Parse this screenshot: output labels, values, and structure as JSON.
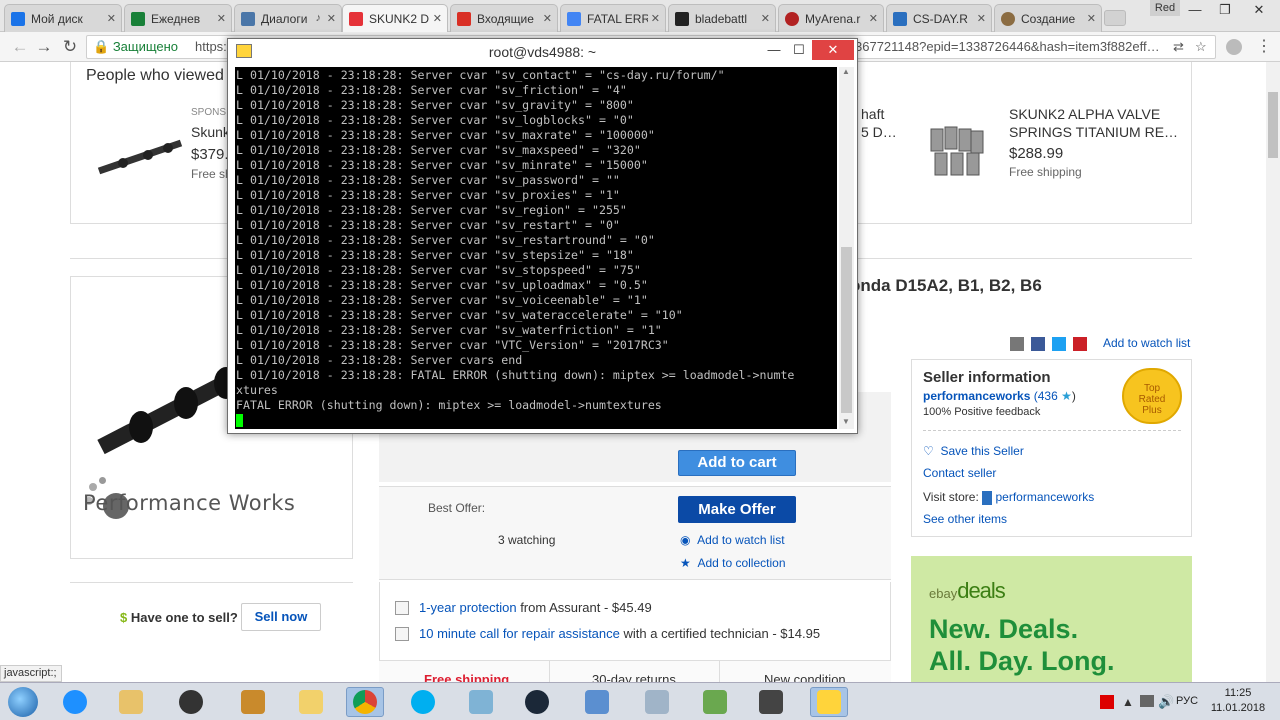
{
  "browser": {
    "tabs": [
      {
        "label": "Мой диск",
        "color": "#1a73e8"
      },
      {
        "label": "Ежеднев",
        "color": "#188038"
      },
      {
        "label": "Диалоги",
        "color": "#4a76a8"
      },
      {
        "label": "SKUNK2 D",
        "color": "#e53238"
      },
      {
        "label": "Входящие",
        "color": "#d93025"
      },
      {
        "label": "FATAL ERR",
        "color": "#4285f4"
      },
      {
        "label": "bladebattl",
        "color": "#222222"
      },
      {
        "label": "MyArena.r",
        "color": "#b22222"
      },
      {
        "label": "CS-DAY.R",
        "color": "#2a6fbf"
      },
      {
        "label": "Создание",
        "color": "#8b6c42"
      }
    ],
    "profile_label": "Red",
    "secure_label": "Защищено",
    "url_start": "https:",
    "url_tail": "367721148?epid=1338726446&hash=item3f882eff…",
    "status_text": "javascript:;"
  },
  "page": {
    "people_viewed": "People who viewed",
    "sponsored": "SPONS",
    "item1": {
      "title": "Skunk",
      "price": "$379.",
      "shipping": "Free sh"
    },
    "item2": {
      "title_l1": "haft",
      "title_l2": "5 D…"
    },
    "item3": {
      "title_l1": "SKUNK2 ALPHA VALVE",
      "title_l2": "SPRINGS TITANIUM RE…",
      "price": "$288.99",
      "shipping": "Free shipping"
    },
    "main_title": "onda D15A2, B1, B2, B6",
    "add_to_watch_top": "Add to watch list",
    "seller": {
      "heading": "Seller information",
      "name": "performanceworks",
      "score": "(436",
      "score_close": ")",
      "feedback": "100% Positive feedback",
      "badge_l1": "Top",
      "badge_l2": "Rated",
      "badge_l3": "Plus",
      "save": "Save this Seller",
      "contact": "Contact seller",
      "visit_label": "Visit store:",
      "store": "performanceworks",
      "other": "See other items"
    },
    "logo_text": "Performance Works",
    "add_to_cart": "Add to cart",
    "best_offer": "Best Offer:",
    "make_offer": "Make Offer",
    "watching": "3 watching",
    "add_watch": "Add to watch list",
    "add_collection": "Add to collection",
    "protection": {
      "link": "1-year protection",
      "rest": "from Assurant - $45.49"
    },
    "repair": {
      "link": "10 minute call for repair assistance",
      "rest": "with a certified technician - $14.95"
    },
    "bottom_free": "Free shipping",
    "bottom_returns": "30-day returns",
    "bottom_cond": "New condition",
    "sell_question": "Have one to sell?",
    "sell_now": "Sell now",
    "deals": {
      "brand_ebay": "ebay",
      "brand_deals": "deals",
      "line1": "New. Deals.",
      "line2": "All. Day. Long."
    }
  },
  "terminal": {
    "title": "root@vds4988: ~",
    "lines": [
      "L 01/10/2018 - 23:18:28: Server cvar \"sv_contact\" = \"cs-day.ru/forum/\"",
      "L 01/10/2018 - 23:18:28: Server cvar \"sv_friction\" = \"4\"",
      "L 01/10/2018 - 23:18:28: Server cvar \"sv_gravity\" = \"800\"",
      "L 01/10/2018 - 23:18:28: Server cvar \"sv_logblocks\" = \"0\"",
      "L 01/10/2018 - 23:18:28: Server cvar \"sv_maxrate\" = \"100000\"",
      "L 01/10/2018 - 23:18:28: Server cvar \"sv_maxspeed\" = \"320\"",
      "L 01/10/2018 - 23:18:28: Server cvar \"sv_minrate\" = \"15000\"",
      "L 01/10/2018 - 23:18:28: Server cvar \"sv_password\" = \"\"",
      "L 01/10/2018 - 23:18:28: Server cvar \"sv_proxies\" = \"1\"",
      "L 01/10/2018 - 23:18:28: Server cvar \"sv_region\" = \"255\"",
      "L 01/10/2018 - 23:18:28: Server cvar \"sv_restart\" = \"0\"",
      "L 01/10/2018 - 23:18:28: Server cvar \"sv_restartround\" = \"0\"",
      "L 01/10/2018 - 23:18:28: Server cvar \"sv_stepsize\" = \"18\"",
      "L 01/10/2018 - 23:18:28: Server cvar \"sv_stopspeed\" = \"75\"",
      "L 01/10/2018 - 23:18:28: Server cvar \"sv_uploadmax\" = \"0.5\"",
      "L 01/10/2018 - 23:18:28: Server cvar \"sv_voiceenable\" = \"1\"",
      "L 01/10/2018 - 23:18:28: Server cvar \"sv_wateraccelerate\" = \"10\"",
      "L 01/10/2018 - 23:18:28: Server cvar \"sv_waterfriction\" = \"1\"",
      "L 01/10/2018 - 23:18:28: Server cvar \"VTC_Version\" = \"2017RC3\"",
      "L 01/10/2018 - 23:18:28: Server cvars end",
      "L 01/10/2018 - 23:18:28: FATAL ERROR (shutting down): miptex >= loadmodel->numte",
      "xtures",
      "FATAL ERROR (shutting down): miptex >= loadmodel->numtextures"
    ]
  },
  "taskbar": {
    "language": "РУС",
    "time": "11:25",
    "date": "11.01.2018"
  }
}
